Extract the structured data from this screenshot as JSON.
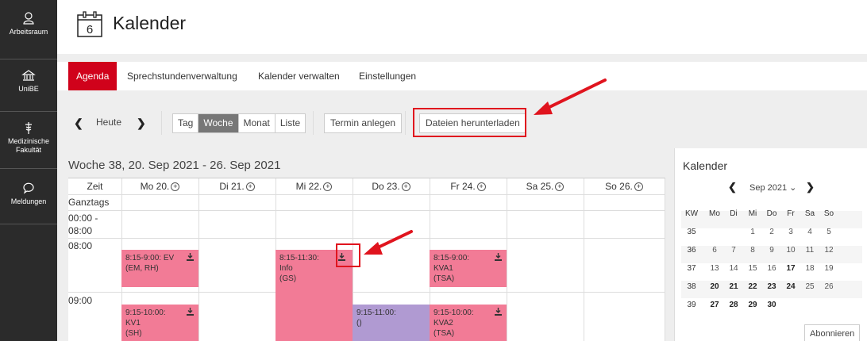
{
  "sidebar": {
    "items": [
      {
        "label": "Arbeitsraum",
        "icon": "person-icon"
      },
      {
        "label": "UniBE",
        "icon": "building-icon"
      },
      {
        "label": "Medizinische Fakultät",
        "icon": "caduceus-icon"
      },
      {
        "label": "Meldungen",
        "icon": "chat-icon"
      }
    ]
  },
  "header": {
    "title": "Kalender",
    "icon_day": "6"
  },
  "tabs": [
    {
      "label": "Agenda",
      "active": true
    },
    {
      "label": "Sprechstundenverwaltung",
      "active": false
    },
    {
      "label": "Kalender verwalten",
      "active": false
    },
    {
      "label": "Einstellungen",
      "active": false
    }
  ],
  "toolbar": {
    "today_label": "Heute",
    "views": [
      "Tag",
      "Woche",
      "Monat",
      "Liste"
    ],
    "active_view": "Woche",
    "new_event_label": "Termin anlegen",
    "download_label": "Dateien herunterladen"
  },
  "week": {
    "title": "Woche 38, 20. Sep 2021 - 26. Sep 2021",
    "time_header": "Zeit",
    "days": [
      "Mo 20.",
      "Di 21.",
      "Mi 22.",
      "Do 23.",
      "Fr 24.",
      "Sa 25.",
      "So 26."
    ],
    "allday_label": "Ganztags",
    "rows": [
      "00:00 -",
      "08:00",
      "08:00",
      "09:00"
    ],
    "events": [
      {
        "day": "Mo",
        "l1": "8:15-9:00: EV",
        "l2": "(EM, RH)",
        "l3": ""
      },
      {
        "day": "Mi",
        "l1": "8:15-11:30:",
        "l2": "Info",
        "l3": "(GS)"
      },
      {
        "day": "Fr",
        "l1": "8:15-9:00:",
        "l2": "KVA1",
        "l3": "(TSA)"
      },
      {
        "day": "Mo",
        "l1": "9:15-10:00:",
        "l2": "KV1",
        "l3": "(SH)"
      },
      {
        "day": "Do",
        "l1": "9:15-11:00:",
        "l2": "()",
        "l3": ""
      },
      {
        "day": "Fr",
        "l1": "9:15-10:00:",
        "l2": "KVA2",
        "l3": "(TSA)"
      }
    ]
  },
  "mini_calendar": {
    "title": "Kalender",
    "month_label": "Sep 2021",
    "headers": [
      "KW",
      "Mo",
      "Di",
      "Mi",
      "Do",
      "Fr",
      "Sa",
      "So"
    ],
    "weeks": [
      [
        "35",
        "",
        "",
        "1",
        "2",
        "3",
        "4",
        "5"
      ],
      [
        "36",
        "6",
        "7",
        "8",
        "9",
        "10",
        "11",
        "12"
      ],
      [
        "37",
        "13",
        "14",
        "15",
        "16",
        "17",
        "18",
        "19"
      ],
      [
        "38",
        "20",
        "21",
        "22",
        "23",
        "24",
        "25",
        "26"
      ],
      [
        "39",
        "27",
        "28",
        "29",
        "30",
        "",
        "",
        ""
      ]
    ],
    "subscribe_label": "Abonnieren"
  },
  "colors": {
    "accent": "#d0021b",
    "event_pink": "#f27b96",
    "event_violet": "#b09ad2",
    "annotation": "#e0141e"
  }
}
